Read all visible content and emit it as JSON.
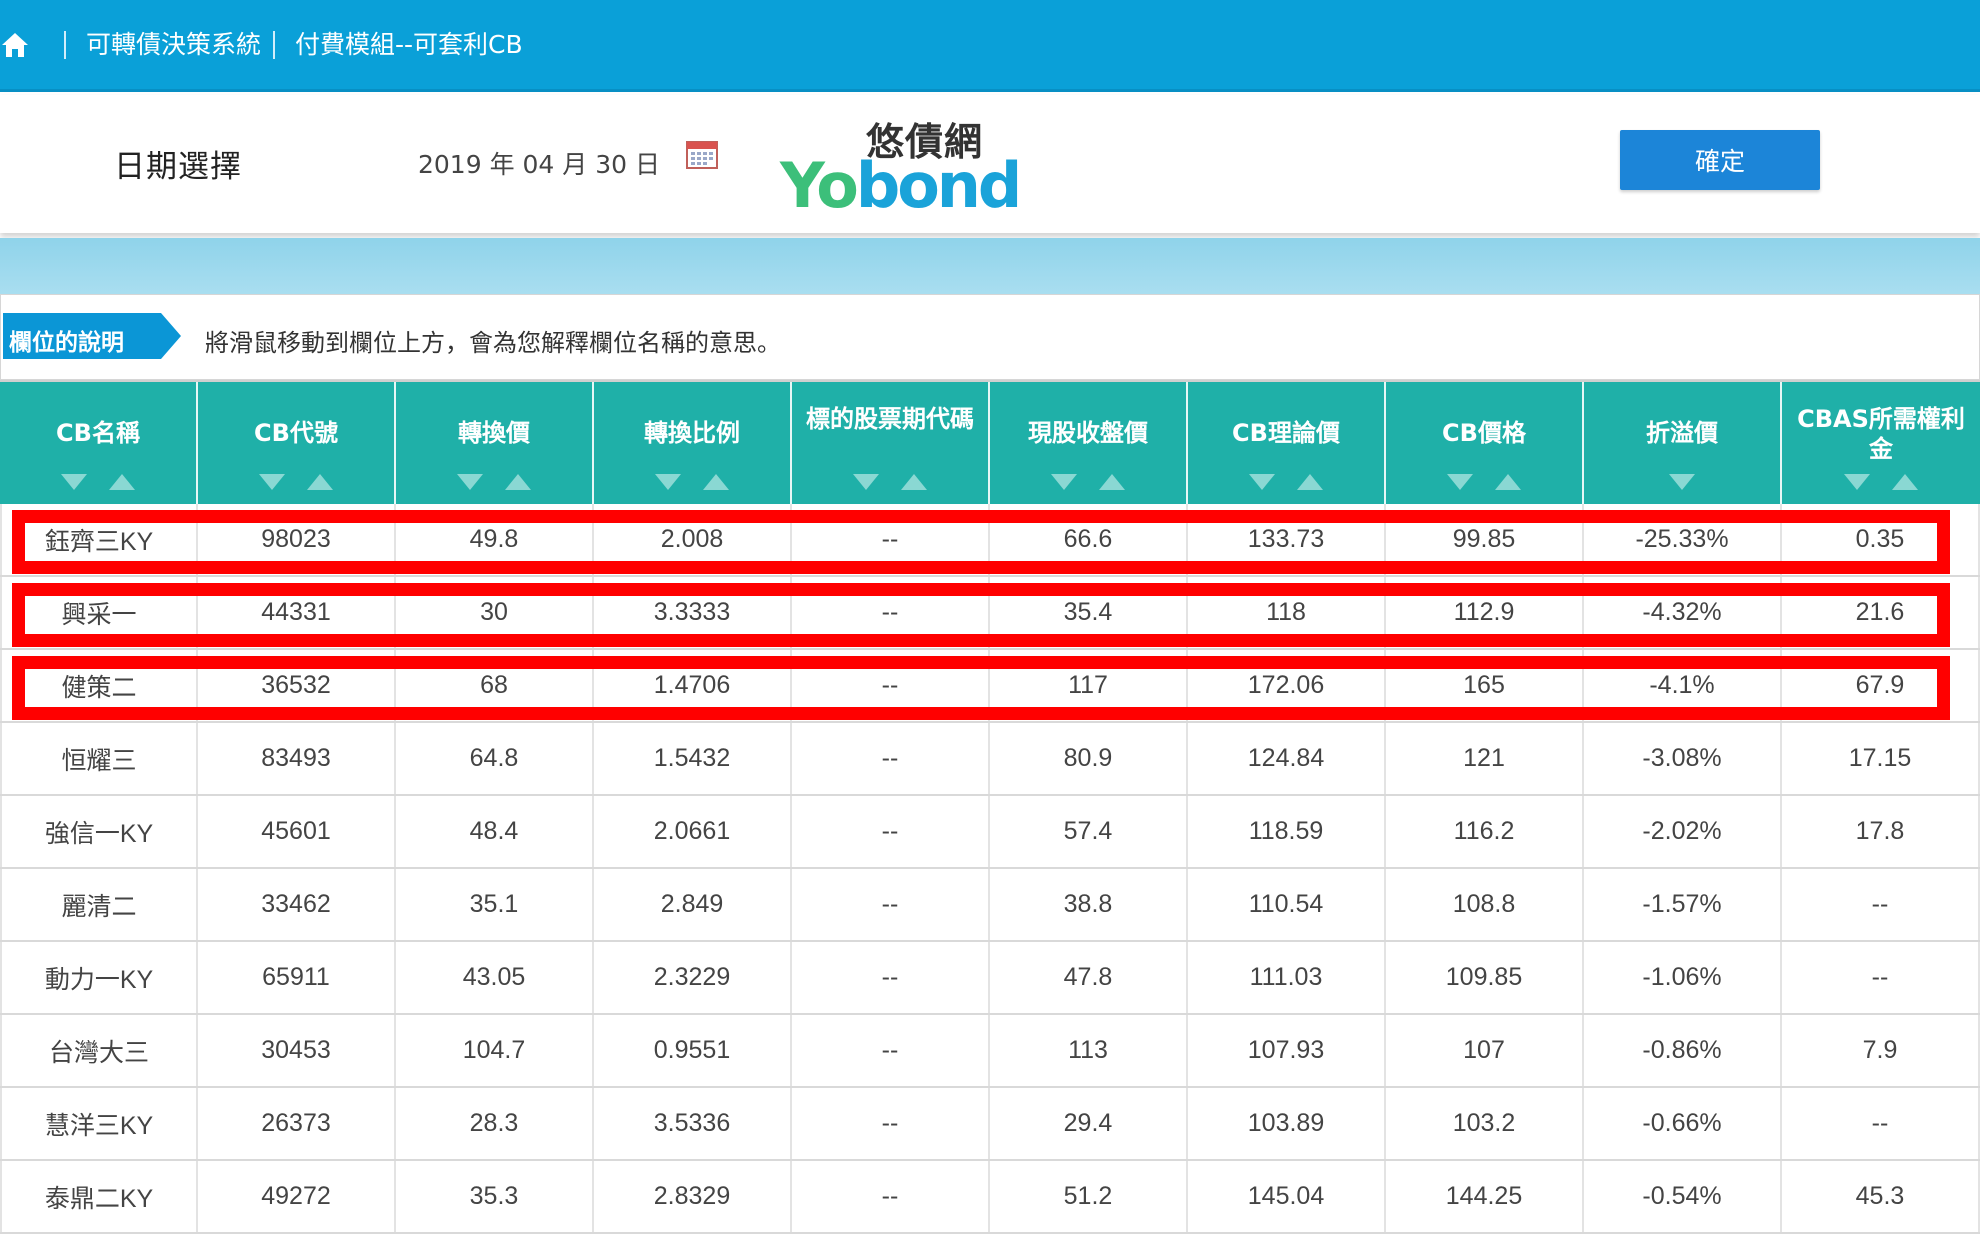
{
  "nav": {
    "crumbs": [
      "可轉債決策系統",
      "付費模組--可套利CB"
    ]
  },
  "date_row": {
    "label": "日期選擇",
    "date": "2019 年 04 月 30 日",
    "confirm_label": "確定"
  },
  "logo": {
    "cn": "悠債網",
    "en": "bond"
  },
  "explain": {
    "tag": "欄位的說明",
    "text": "將滑鼠移動到欄位上方，會為您解釋欄位名稱的意思。"
  },
  "table": {
    "columns": [
      {
        "label": "CB名稱",
        "sort_down": true,
        "sort_up": true
      },
      {
        "label": "CB代號",
        "sort_down": true,
        "sort_up": true
      },
      {
        "label": "轉換價",
        "sort_down": true,
        "sort_up": true
      },
      {
        "label": "轉換比例",
        "sort_down": true,
        "sort_up": true
      },
      {
        "label": "標的股票期代碼",
        "sort_down": true,
        "sort_up": true
      },
      {
        "label": "現股收盤價",
        "sort_down": true,
        "sort_up": true
      },
      {
        "label": "CB理論價",
        "sort_down": true,
        "sort_up": true
      },
      {
        "label": "CB價格",
        "sort_down": true,
        "sort_up": true
      },
      {
        "label": "折溢價",
        "sort_down": true,
        "sort_up": false
      },
      {
        "label": "CBAS所需權利金",
        "sort_down": true,
        "sort_up": true
      }
    ],
    "rows": [
      {
        "cells": [
          "鈺齊三KY",
          "98023",
          "49.8",
          "2.008",
          "--",
          "66.6",
          "133.73",
          "99.85",
          "-25.33%",
          "0.35"
        ],
        "highlighted": true
      },
      {
        "cells": [
          "興采一",
          "44331",
          "30",
          "3.3333",
          "--",
          "35.4",
          "118",
          "112.9",
          "-4.32%",
          "21.6"
        ],
        "highlighted": true
      },
      {
        "cells": [
          "健策二",
          "36532",
          "68",
          "1.4706",
          "--",
          "117",
          "172.06",
          "165",
          "-4.1%",
          "67.9"
        ],
        "highlighted": true
      },
      {
        "cells": [
          "恒耀三",
          "83493",
          "64.8",
          "1.5432",
          "--",
          "80.9",
          "124.84",
          "121",
          "-3.08%",
          "17.15"
        ],
        "highlighted": false
      },
      {
        "cells": [
          "強信一KY",
          "45601",
          "48.4",
          "2.0661",
          "--",
          "57.4",
          "118.59",
          "116.2",
          "-2.02%",
          "17.8"
        ],
        "highlighted": false
      },
      {
        "cells": [
          "麗清二",
          "33462",
          "35.1",
          "2.849",
          "--",
          "38.8",
          "110.54",
          "108.8",
          "-1.57%",
          "--"
        ],
        "highlighted": false
      },
      {
        "cells": [
          "動力一KY",
          "65911",
          "43.05",
          "2.3229",
          "--",
          "47.8",
          "111.03",
          "109.85",
          "-1.06%",
          "--"
        ],
        "highlighted": false
      },
      {
        "cells": [
          "台灣大三",
          "30453",
          "104.7",
          "0.9551",
          "--",
          "113",
          "107.93",
          "107",
          "-0.86%",
          "7.9"
        ],
        "highlighted": false
      },
      {
        "cells": [
          "慧洋三KY",
          "26373",
          "28.3",
          "3.5336",
          "--",
          "29.4",
          "103.89",
          "103.2",
          "-0.66%",
          "--"
        ],
        "highlighted": false
      },
      {
        "cells": [
          "泰鼎二KY",
          "49272",
          "35.3",
          "2.8329",
          "--",
          "51.2",
          "145.04",
          "144.25",
          "-0.54%",
          "45.3"
        ],
        "highlighted": false
      }
    ]
  },
  "colors": {
    "nav": "#0aa0d8",
    "header": "#1fb0a8",
    "highlight": "#ff0000",
    "button": "#1c85d8"
  }
}
